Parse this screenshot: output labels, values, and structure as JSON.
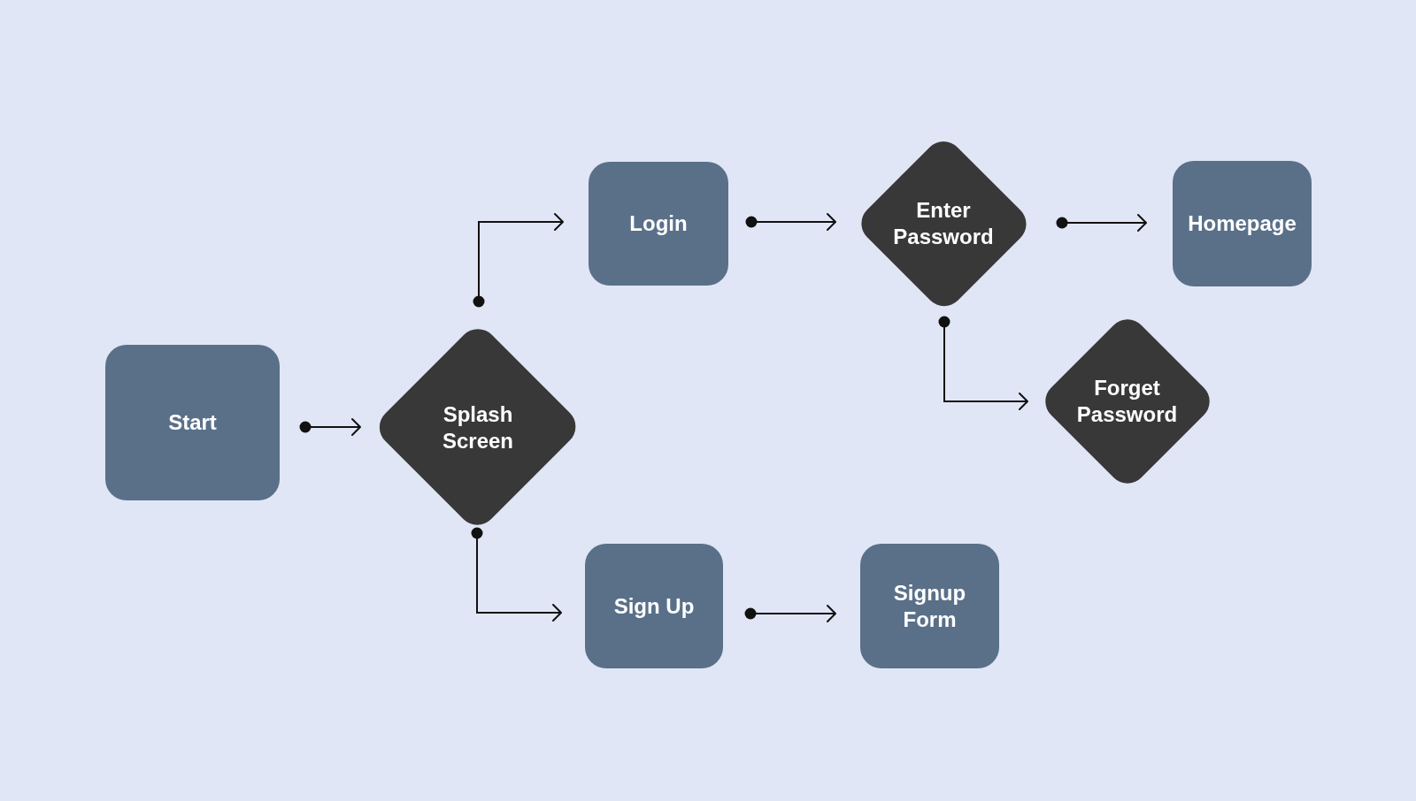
{
  "flowchart": {
    "nodes": [
      {
        "label": "Start",
        "kind": "process",
        "children": [
          {
            "label": "Splash Screen",
            "kind": "decision",
            "children": [
              {
                "label": "Login",
                "kind": "process",
                "children": [
                  {
                    "label": "Enter Password",
                    "kind": "decision",
                    "children": [
                      {
                        "label": "Homepage",
                        "kind": "process"
                      },
                      {
                        "label": "Forget Password",
                        "kind": "decision"
                      }
                    ]
                  }
                ]
              },
              {
                "label": "Sign Up",
                "kind": "process",
                "children": [
                  {
                    "label": "Signup Form",
                    "kind": "process"
                  }
                ]
              }
            ]
          }
        ]
      }
    ]
  }
}
